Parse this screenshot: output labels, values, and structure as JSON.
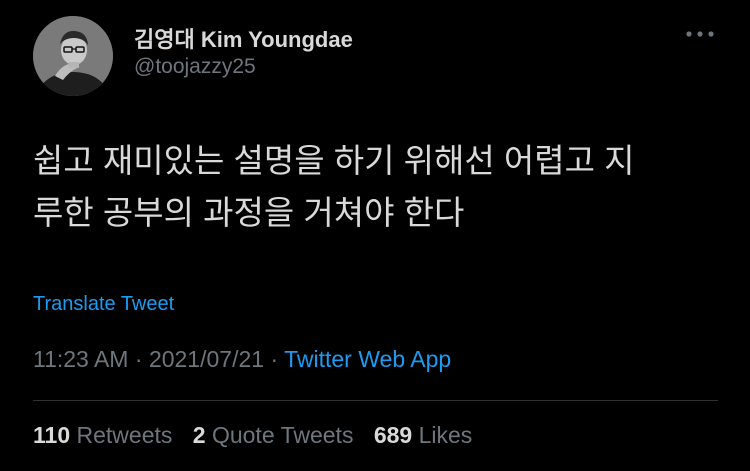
{
  "tweet": {
    "author": {
      "display_name": "김영대 Kim Youngdae",
      "handle": "@toojazzy25"
    },
    "more_icon": "more-horizontal-icon",
    "text_lines": [
      "쉽고 재미있는 설명을 하기 위해선 어렵고 지",
      "루한 공부의 과정을 거쳐야 한다"
    ],
    "translate_label": "Translate Tweet",
    "time": "11:23 AM",
    "separator": "·",
    "date": "2021/07/21",
    "source": "Twitter Web App",
    "stats": {
      "retweets_count": "110",
      "retweets_label": "Retweets",
      "quote_count": "2",
      "quote_label": "Quote Tweets",
      "likes_count": "689",
      "likes_label": "Likes"
    }
  },
  "colors": {
    "background": "#000000",
    "text": "#d9d9d9",
    "secondary": "#6e767d",
    "link": "#1d9bf0",
    "divider": "#2f3336"
  }
}
